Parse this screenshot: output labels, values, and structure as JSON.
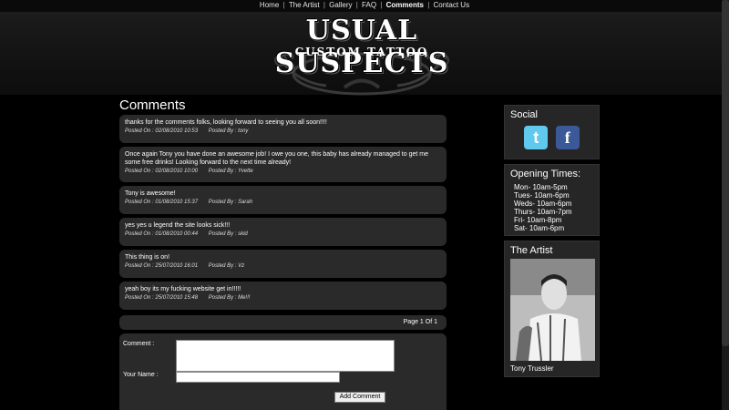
{
  "nav": {
    "items": [
      {
        "label": "Home"
      },
      {
        "label": "The Artist"
      },
      {
        "label": "Gallery"
      },
      {
        "label": "FAQ"
      },
      {
        "label": "Comments"
      },
      {
        "label": "Contact Us"
      }
    ],
    "separator": "|",
    "active": "Comments"
  },
  "logo": {
    "title": "USUAL SUSPECTS",
    "subtitle": "CUSTOM TATTOO"
  },
  "main": {
    "title": "Comments",
    "comments": [
      {
        "text": "thanks for the comments folks, looking forward to seeing you all soon!!!!",
        "posted_on": "Posted On : 02/08/2010 10:53",
        "posted_by": "Posted By : tony"
      },
      {
        "text": "Once again Tony you have done an awesome job! I owe you one, this baby has already managed to get me some free drinks! Looking forward to the next time already!",
        "posted_on": "Posted On : 02/08/2010 10:00",
        "posted_by": "Posted By : Yvette"
      },
      {
        "text": "Tony is awesome!",
        "posted_on": "Posted On : 01/08/2010 15:37",
        "posted_by": "Posted By : Sarah"
      },
      {
        "text": "yes yes u legend the site looks sick!!!",
        "posted_on": "Posted On : 01/08/2010 00:44",
        "posted_by": "Posted By : skid"
      },
      {
        "text": "This thing is on!",
        "posted_on": "Posted On : 25/07/2010 16:01",
        "posted_by": "Posted By : Vz"
      },
      {
        "text": "yeah boy its my fucking website get in!!!!!",
        "posted_on": "Posted On : 25/07/2010 15:48",
        "posted_by": "Posted By : Me!!!"
      }
    ],
    "pager": "Page 1 Of 1",
    "form": {
      "comment_label": "Comment :",
      "comment_value": "",
      "name_label": "Your Name :",
      "name_value": "",
      "submit_label": "Add Comment"
    }
  },
  "sidebar": {
    "social": {
      "title": "Social",
      "icons": [
        {
          "name": "twitter-icon",
          "glyph": "t"
        },
        {
          "name": "facebook-icon",
          "glyph": "f"
        }
      ]
    },
    "opening_times": {
      "title": "Opening Times:",
      "rows": [
        "Mon- 10am-5pm",
        "Tues- 10am-6pm",
        "Weds- 10am-6pm",
        "Thurs- 10am-7pm",
        "Fri- 10am-8pm",
        "Sat- 10am-6pm"
      ]
    },
    "artist": {
      "title": "The Artist",
      "name": "Tony Trussler"
    }
  },
  "colors": {
    "background": "#000000",
    "panel": "#2a2a2a",
    "twitter": "#5fc9ee",
    "facebook": "#3b5998"
  }
}
